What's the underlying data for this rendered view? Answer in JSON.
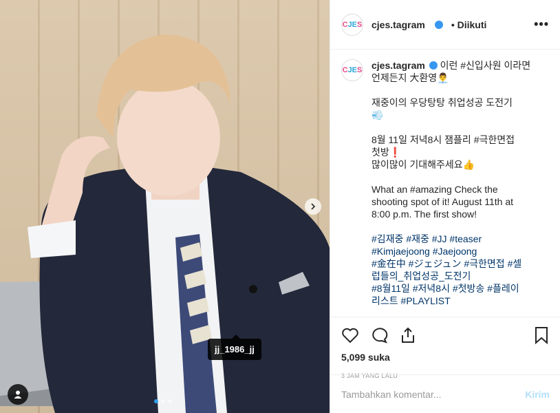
{
  "post": {
    "tag_label": "jj_1986_jj"
  },
  "header": {
    "username": "cjes.tagram",
    "follow_label": "Diikuti",
    "separator": "•",
    "more_label": "•••",
    "avatar_letters": [
      "C",
      "JE",
      "S"
    ]
  },
  "caption": {
    "username": "cjes.tagram",
    "lines": [
      "이런 #신입사원 이라면",
      "언제든지 大환영👨‍💼",
      "",
      "재중이의 우당탕탕 취업성공 도전기",
      "💨",
      "",
      "8월 11일 저녁8시 잼플리 #극한면접",
      "첫방❗",
      "많이많이 기대해주세요👍",
      "",
      "What an #amazing Check the",
      "shooting spot of it! August 11th at",
      "8:00 p.m. The first show!",
      "",
      "#김재중 #재중 #JJ #teaser",
      "#Kimjaejoong #Jaejoong",
      "#金在中 #ジェジュン #극한면접 #셀",
      "럽들의_취업성공_도전기",
      "#8월11일 #저녁8시 #첫방송 #플레이",
      "리스트 #PLAYLIST"
    ]
  },
  "stats": {
    "likes": "5,099 suka",
    "time": "3 JAM YANG LALU"
  },
  "comment": {
    "placeholder": "Tambahkan komentar...",
    "send_label": "Kirim"
  },
  "colors": {
    "link": "#003569",
    "verified": "#3897f0",
    "send_disabled": "#b2dffc"
  }
}
